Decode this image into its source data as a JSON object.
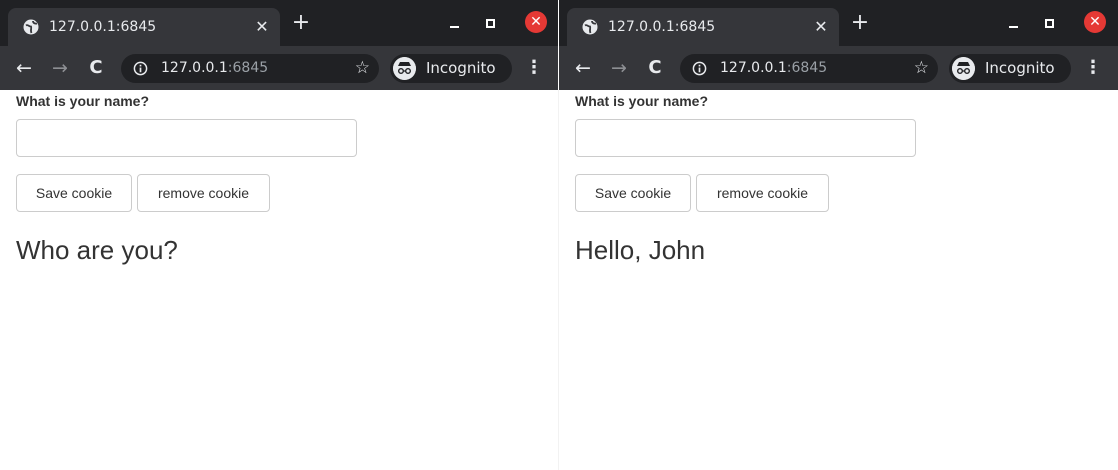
{
  "windows": [
    {
      "tab": {
        "title": "127.0.0.1:6845",
        "favicon": "globe-icon"
      },
      "address": {
        "host": "127.0.0.1",
        "port": ":6845"
      },
      "incognito_label": "Incognito",
      "form": {
        "label": "What is your name?",
        "input_value": "",
        "save_label": "Save cookie",
        "remove_label": "remove cookie"
      },
      "greeting": "Who are you?"
    },
    {
      "tab": {
        "title": "127.0.0.1:6845",
        "favicon": "globe-icon"
      },
      "address": {
        "host": "127.0.0.1",
        "port": ":6845"
      },
      "incognito_label": "Incognito",
      "form": {
        "label": "What is your name?",
        "input_value": "",
        "save_label": "Save cookie",
        "remove_label": "remove cookie"
      },
      "greeting": "Hello, John"
    }
  ],
  "colors": {
    "titlebar": "#202124",
    "toolbar": "#35363a",
    "close_button": "#e53935",
    "text_dark": "#333333"
  }
}
